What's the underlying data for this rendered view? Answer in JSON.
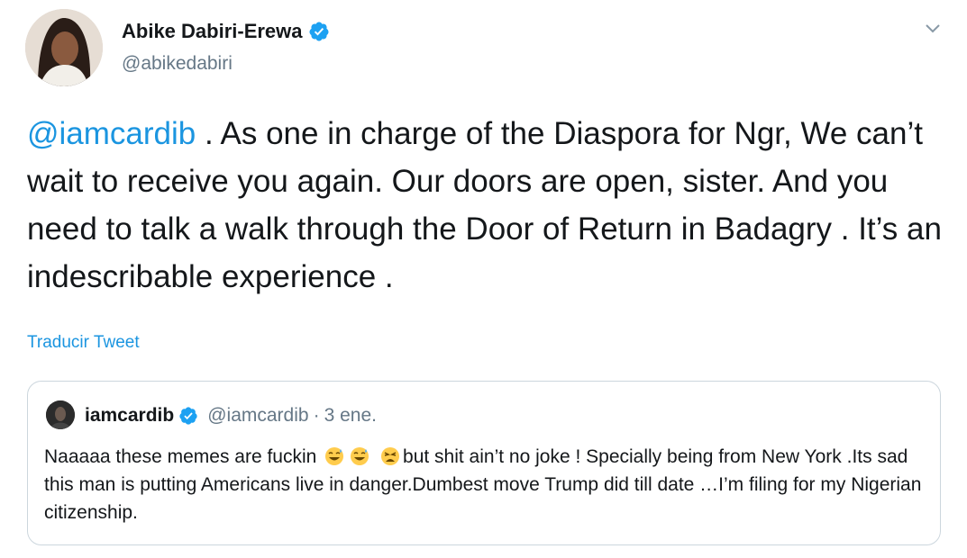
{
  "author": {
    "name": "Abike Dabiri-Erewa",
    "handle": "@abikedabiri"
  },
  "tweet": {
    "mention": "@iamcardib",
    "text": " . As one in charge of the Diaspora for Ngr, We can’t wait to receive you again. Our doors are open, sister. And you need to talk a walk through the Door of Return in Badagry . It’s an indescribable experience ."
  },
  "translate_label": "Traducir Tweet",
  "quoted": {
    "name": "iamcardib",
    "handle": "@iamcardib",
    "separator": "·",
    "date": "3 ene.",
    "text_before_emoji": "Naaaaa these memes are fuckin",
    "text_after_emoji": "but shit ain’t no joke ! Specially being from New York .Its sad this man is putting Americans live in danger.Dumbest move Trump did till date …I’m filing for my Nigerian citizenship.",
    "emojis": [
      "sweat-smile-emoji",
      "sweat-smile-emoji",
      "tired-face-emoji"
    ]
  },
  "colors": {
    "link": "#1b95e0",
    "verified": "#1da1f2",
    "secondary_text": "#657786",
    "border": "#ccd6dd"
  }
}
